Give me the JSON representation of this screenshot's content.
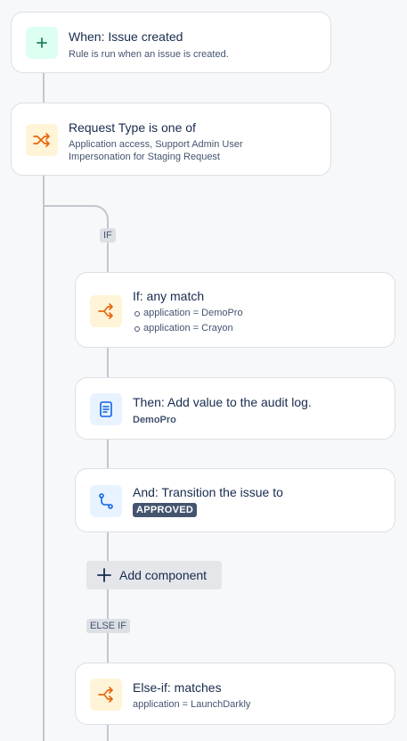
{
  "trigger": {
    "title": "When: Issue created",
    "subtitle": "Rule is run when an issue is created.",
    "icon": "plus-icon"
  },
  "condition": {
    "title": "Request Type is one of",
    "subtitle": "Application access, Support Admin User Impersonation for Staging Request",
    "icon": "shuffle-icon"
  },
  "branch": {
    "if_tag": "IF",
    "if_card": {
      "title": "If: any match",
      "items": [
        "application = DemoPro",
        "application = Crayon"
      ],
      "icon": "branch-icon"
    },
    "then_card": {
      "title": "Then: Add value to the audit log.",
      "subtitle": "DemoPro",
      "icon": "document-icon"
    },
    "and_card": {
      "title": "And: Transition the issue to",
      "status": "APPROVED",
      "icon": "transition-icon"
    },
    "add_component_label": "Add component",
    "else_if_tag": "ELSE IF",
    "else_if_card": {
      "title": "Else-if: matches",
      "subtitle": "application = LaunchDarkly",
      "icon": "branch-icon"
    }
  },
  "colors": {
    "background": "#f7f8f9",
    "card_border": "#dcdfe4",
    "connector": "#c1c7d0",
    "trigger_icon": "#1f845a",
    "condition_icon": "#e56910",
    "action_icon": "#0c66e4",
    "lozenge": "#44546f"
  }
}
